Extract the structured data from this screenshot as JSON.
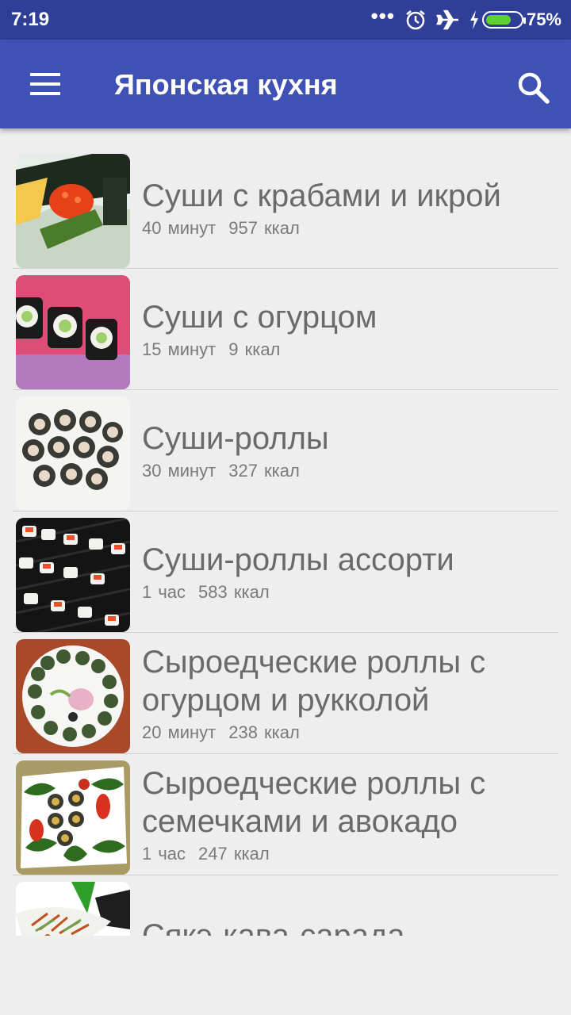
{
  "status_bar": {
    "time": "7:19",
    "dots": "•••",
    "battery_percent": "75%",
    "battery_level": 0.75,
    "icons": [
      "alarm-icon",
      "airplane-icon",
      "charging-icon",
      "battery-icon"
    ]
  },
  "app_bar": {
    "title": "Японская кухня",
    "color": "#3f51b5",
    "icons": [
      "menu-icon",
      "search-icon"
    ]
  },
  "recipes": [
    {
      "title": "Суши с крабами и икрой",
      "time": "40 минут",
      "calories": "957 ккал"
    },
    {
      "title": "Суши с огурцом",
      "time": "15 минут",
      "calories": "9 ккал"
    },
    {
      "title": "Суши-роллы",
      "time": "30 минут",
      "calories": "327 ккал"
    },
    {
      "title": "Суши-роллы ассорти",
      "time": "1 час",
      "calories": "583 ккал"
    },
    {
      "title": "Сыроедческие роллы с огурцом и рукколой",
      "time": "20 минут",
      "calories": "238 ккал"
    },
    {
      "title": "Сыроедческие роллы с семечками и авокадо",
      "time": "1 час",
      "calories": "247 ккал"
    },
    {
      "title": "Сякэ-кава-сарада",
      "time": "",
      "calories": ""
    }
  ]
}
